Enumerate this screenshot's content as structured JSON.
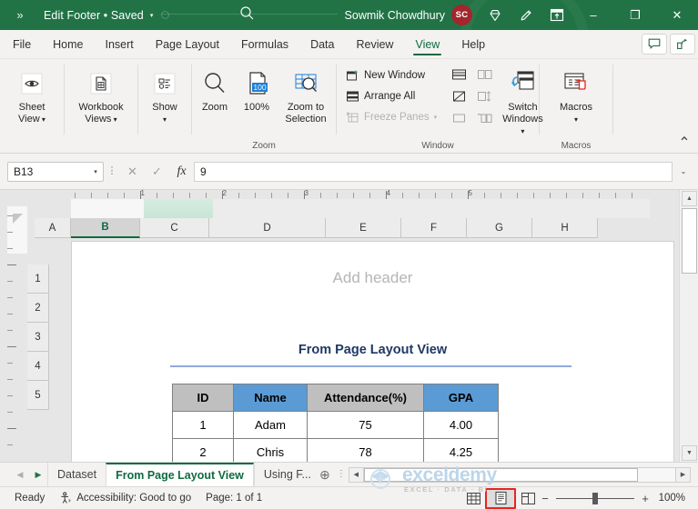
{
  "titlebar": {
    "chevron": "»",
    "doc_title": "Edit Footer • Saved",
    "caret": "▾",
    "user_name": "Sowmik Chowdhury",
    "avatar_initials": "SC",
    "icons": [
      "diamond-icon",
      "pen-icon",
      "ribbon-display-options-icon"
    ],
    "minimize": "–",
    "maximize": "❐",
    "close": "✕",
    "accent_color": "#217346"
  },
  "ribbon_tabs": {
    "items": [
      {
        "label": "File",
        "active": false
      },
      {
        "label": "Home",
        "active": false
      },
      {
        "label": "Insert",
        "active": false
      },
      {
        "label": "Page Layout",
        "active": false
      },
      {
        "label": "Formulas",
        "active": false
      },
      {
        "label": "Data",
        "active": false
      },
      {
        "label": "Review",
        "active": false
      },
      {
        "label": "View",
        "active": true
      },
      {
        "label": "Help",
        "active": false
      }
    ],
    "comments_label": "Comments",
    "share_label": "Share"
  },
  "ribbon": {
    "sheet_view": {
      "line1": "Sheet",
      "line2": "View"
    },
    "workbook_views": {
      "line1": "Workbook",
      "line2": "Views"
    },
    "show": {
      "line1": "Show",
      "line2": ""
    },
    "zoom_group": {
      "label": "Zoom",
      "zoom": "Zoom",
      "hundred": "100%",
      "zoom_to_selection_1": "Zoom to",
      "zoom_to_selection_2": "Selection",
      "badge": "100"
    },
    "window_group": {
      "label": "Window",
      "new_window": "New Window",
      "arrange_all": "Arrange All",
      "freeze_panes": "Freeze Panes",
      "switch_windows_1": "Switch",
      "switch_windows_2": "Windows"
    },
    "macros_group": {
      "label": "Macros",
      "macros": "Macros"
    },
    "collapse": "⌃"
  },
  "formula_bar": {
    "name_box_value": "B13",
    "cancel": "✕",
    "enter": "✓",
    "fx": "fx",
    "formula_value": "9",
    "expand": "⌄"
  },
  "sheet": {
    "ruler_h_numbers": [
      "1",
      "2",
      "3",
      "4",
      "5"
    ],
    "column_headers": [
      "A",
      "B",
      "C",
      "D",
      "E",
      "F",
      "G",
      "H"
    ],
    "selected_column": "B",
    "row_headers": [
      "1",
      "2",
      "3",
      "4",
      "5"
    ],
    "header_placeholder": "Add header",
    "page_title": "From Page Layout View",
    "table": {
      "headers": [
        "ID",
        "Name",
        "Attendance(%)",
        "GPA"
      ],
      "rows": [
        [
          "1",
          "Adam",
          "75",
          "4.00"
        ],
        [
          "2",
          "Chris",
          "78",
          "4.25"
        ]
      ]
    }
  },
  "sheet_tabs": {
    "prev": "◀",
    "next": "▶",
    "items": [
      {
        "label": "Dataset",
        "active": false
      },
      {
        "label": "From Page Layout View",
        "active": true
      },
      {
        "label": "Using F...",
        "active": false
      }
    ],
    "add": "⊕"
  },
  "watermark": {
    "brand": "exceldemy",
    "tagline": "EXCEL · DATA · BI"
  },
  "status_bar": {
    "state": "Ready",
    "accessibility": "Accessibility: Good to go",
    "page": "Page: 1 of 1",
    "views": [
      {
        "name": "normal-view",
        "highlighted": false
      },
      {
        "name": "page-layout-view",
        "highlighted": true
      },
      {
        "name": "page-break-preview",
        "highlighted": false
      }
    ],
    "zoom_minus": "−",
    "zoom_plus": "+",
    "zoom_percent": "100%",
    "highlight_color": "#e8241f"
  }
}
